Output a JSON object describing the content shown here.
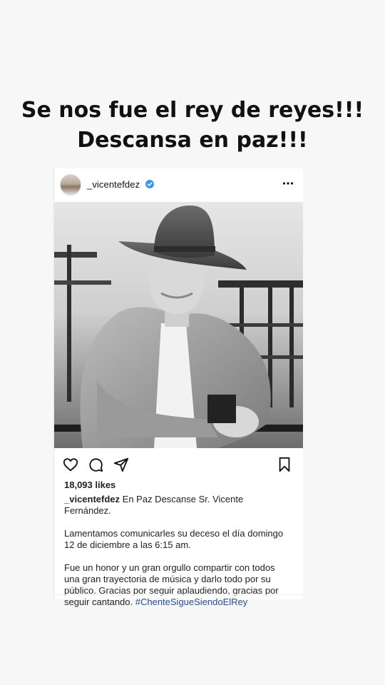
{
  "headline": {
    "line1": "Se nos fue el rey de reyes!!!",
    "line2": "Descansa en paz!!!"
  },
  "post": {
    "username": "_vicentefdez",
    "verified": true,
    "more_icon": "more-horizontal-icon",
    "photo_description_icon": "photo",
    "likes": "18,093 likes",
    "caption_username": "_vicentefdez",
    "caption_first": " En Paz Descanse Sr. Vicente Fernández.",
    "paragraph2": "Lamentamos comunicarles su deceso el día domingo 12 de diciembre a las 6:15 am.",
    "paragraph3_text": "Fue un honor y un gran orgullo compartir con todos una gran trayectoria de música y darlo todo por su público. Gracias por seguir aplaudiendo, gracias por seguir cantando. ",
    "hashtag": "#ChenteSigueSiendoElRey",
    "icons": {
      "like": "heart-icon",
      "comment": "comment-icon",
      "share": "send-icon",
      "save": "bookmark-icon"
    }
  },
  "colors": {
    "background": "#f7f7f7",
    "card": "#ffffff",
    "text": "#222222",
    "hashtag": "#2b4d8b",
    "verified_badge": "#3897f0"
  }
}
